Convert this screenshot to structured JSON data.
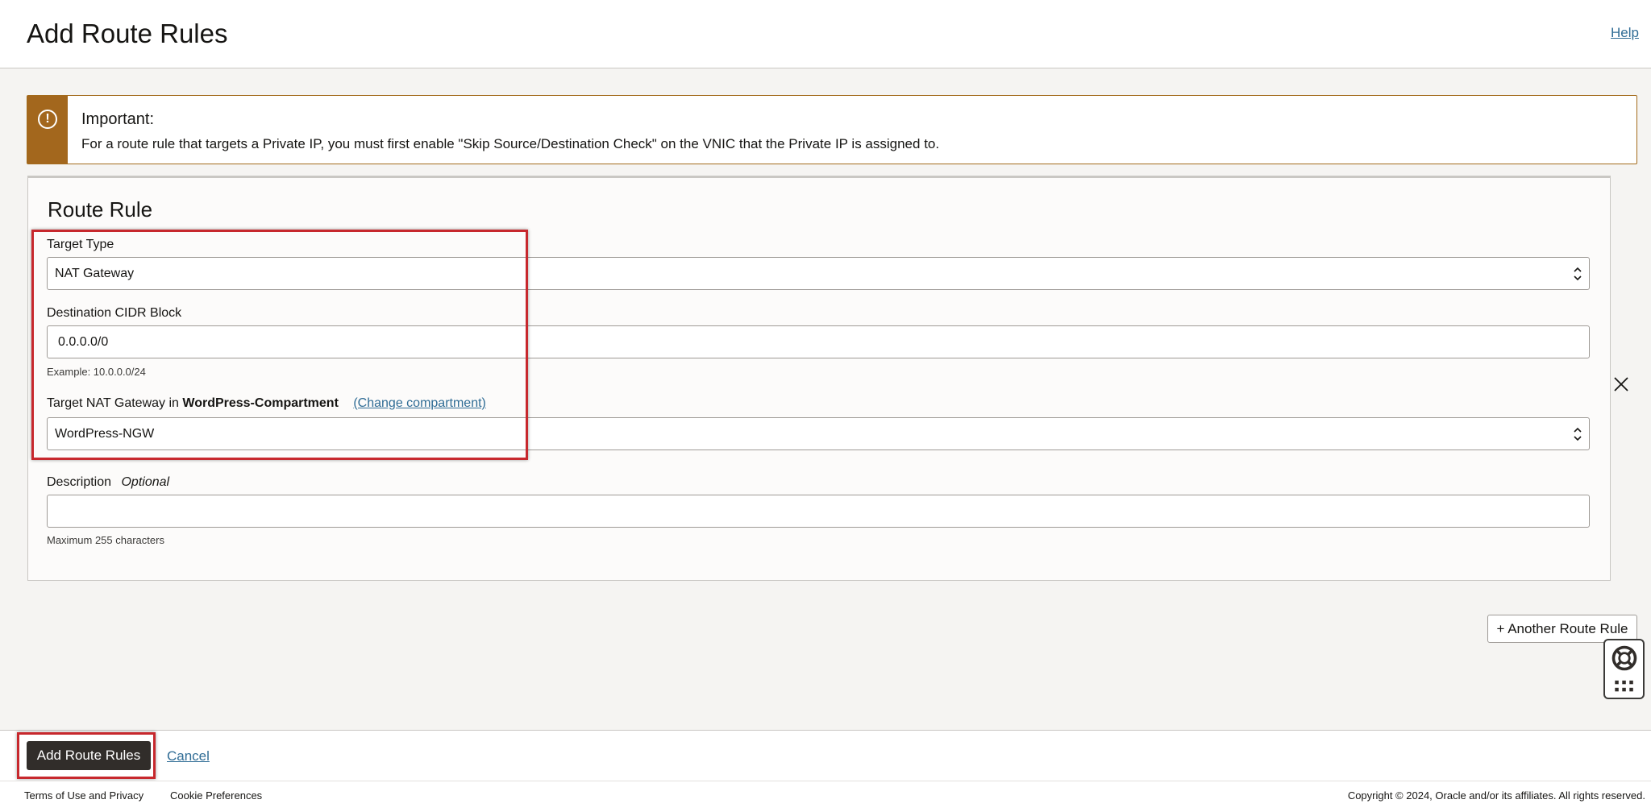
{
  "header": {
    "title": "Add Route Rules",
    "help_label": "Help"
  },
  "alert": {
    "title": "Important:",
    "text": "For a route rule that targets a Private IP, you must first enable \"Skip Source/Destination Check\" on the VNIC that the Private IP is assigned to."
  },
  "rule": {
    "title": "Route Rule",
    "target_type": {
      "label": "Target Type",
      "value": "NAT Gateway"
    },
    "destination": {
      "label": "Destination CIDR Block",
      "value": "0.0.0.0/0",
      "hint": "Example: 10.0.0.0/24"
    },
    "target_gateway": {
      "label_prefix": "Target NAT Gateway in",
      "compartment": "WordPress-Compartment",
      "change_label": "(Change compartment)",
      "value": "WordPress-NGW"
    },
    "description": {
      "label": "Description",
      "optional_label": "Optional",
      "value": "",
      "hint": "Maximum 255 characters"
    }
  },
  "another_rule_label": "+ Another Route Rule",
  "actions": {
    "submit_label": "Add Route Rules",
    "cancel_label": "Cancel"
  },
  "footer": {
    "terms": "Terms of Use and Privacy",
    "cookies": "Cookie Preferences",
    "copyright": "Copyright © 2024, Oracle and/or its affiliates. All rights reserved."
  },
  "colors": {
    "accent_warning": "#a3671d",
    "link": "#2f6c95",
    "highlight": "#c7282d",
    "primary_button": "#312d2a"
  },
  "icons": {
    "alert": "exclamation-circle-icon",
    "close": "close-icon",
    "help_widget": "lifebuoy-icon",
    "apps_widget": "grid-icon"
  }
}
